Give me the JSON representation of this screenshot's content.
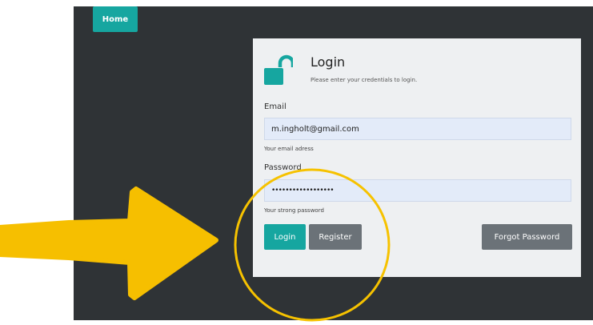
{
  "nav": {
    "home_label": "Home"
  },
  "login": {
    "title": "Login",
    "subtitle": "Please enter your credentials to login.",
    "email": {
      "label": "Email",
      "value": "m.ingholt@gmail.com",
      "hint": "Your email adress"
    },
    "password": {
      "label": "Password",
      "value": "••••••••••••••••••",
      "hint": "Your strong password"
    },
    "buttons": {
      "login": "Login",
      "register": "Register",
      "forgot": "Forgot Password"
    }
  },
  "icons": {
    "lock": "unlocked-padlock-icon",
    "arrow": "arrow-right-icon"
  },
  "colors": {
    "accent": "#16a6a0",
    "secondary_button": "#6b7278",
    "background_dark": "#2f3336",
    "card": "#eef0f2",
    "input": "#e3ebf9",
    "annotation": "#f6bf00"
  }
}
